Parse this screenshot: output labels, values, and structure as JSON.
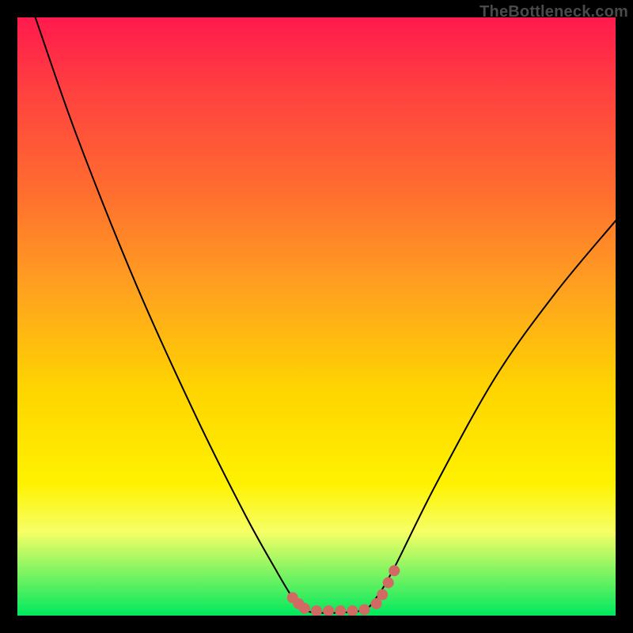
{
  "watermark": "TheBottleneck.com",
  "chart_data": {
    "type": "line",
    "title": "",
    "xlabel": "",
    "ylabel": "",
    "xlim": [
      0,
      100
    ],
    "ylim": [
      0,
      100
    ],
    "series": [
      {
        "name": "curve",
        "x": [
          3,
          10,
          20,
          30,
          38,
          43,
          46,
          48,
          50,
          54,
          58,
          60,
          63,
          70,
          80,
          90,
          100
        ],
        "y": [
          100,
          80,
          55,
          33,
          17,
          8,
          3,
          1,
          0.5,
          0.5,
          1,
          3,
          8,
          22,
          40,
          54,
          66
        ]
      }
    ],
    "markers": {
      "name": "highlight-dots",
      "color": "#d16a63",
      "points": [
        {
          "x": 46,
          "y": 3.0
        },
        {
          "x": 47,
          "y": 2.0
        },
        {
          "x": 48,
          "y": 1.2
        },
        {
          "x": 50,
          "y": 0.8
        },
        {
          "x": 52,
          "y": 0.8
        },
        {
          "x": 54,
          "y": 0.8
        },
        {
          "x": 56,
          "y": 0.8
        },
        {
          "x": 58,
          "y": 1.0
        },
        {
          "x": 60,
          "y": 2.0
        },
        {
          "x": 61,
          "y": 3.5
        },
        {
          "x": 62,
          "y": 5.5
        },
        {
          "x": 63,
          "y": 7.5
        }
      ]
    }
  }
}
